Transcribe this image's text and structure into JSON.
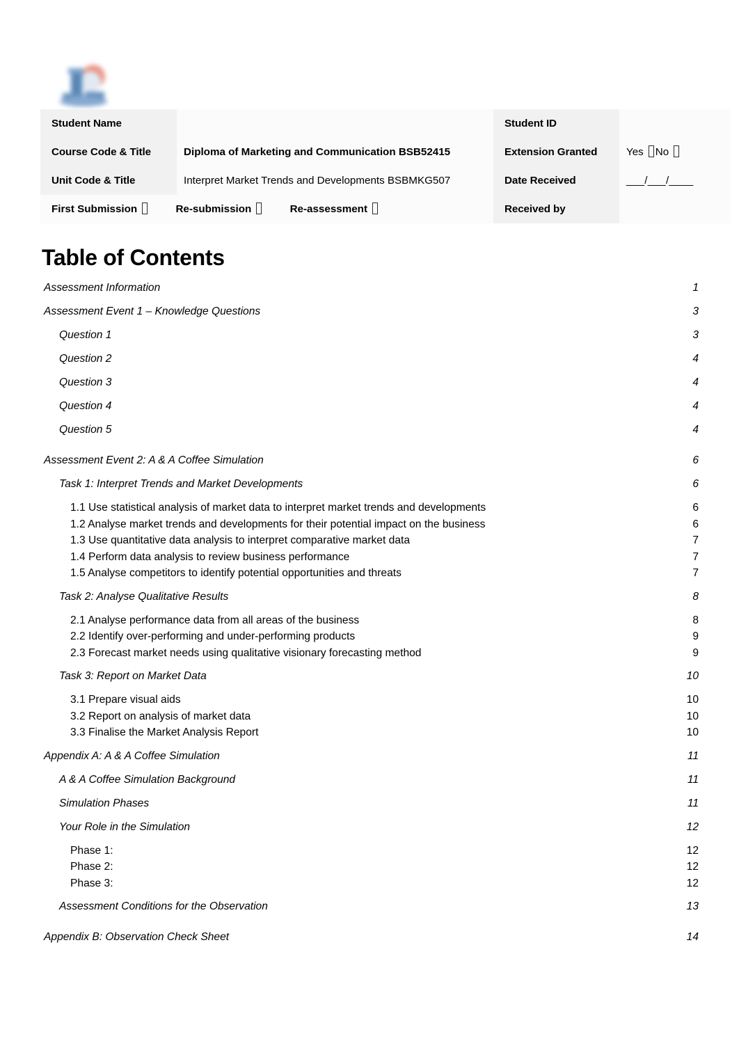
{
  "document": {
    "logo_alt": "institution-logo"
  },
  "header_table": {
    "rows": [
      {
        "left_label": "Student Name",
        "left_value": "",
        "right_label": "Student ID",
        "right_value": ""
      },
      {
        "left_label": "Course Code & Title",
        "left_value": "Diploma of Marketing and Communication BSB52415",
        "right_label": "Extension Granted",
        "right_value": "Yes",
        "right_value_2": "No"
      },
      {
        "left_label": "Unit Code & Title",
        "left_value": "Interpret Market Trends and Developments BSBMKG507",
        "right_label": "Date Received",
        "right_value": "___/___/____"
      }
    ],
    "submission_row": {
      "first_submission": "First Submission",
      "resubmission": "Re-submission",
      "reassessment": "Re-assessment",
      "received_by": "Received by"
    }
  },
  "toc": {
    "title": "Table of Contents",
    "entries": [
      {
        "label": "Assessment Information",
        "page": "1",
        "level": 1
      },
      {
        "label": "Assessment Event 1 – Knowledge Questions",
        "page": "3",
        "level": 1
      },
      {
        "label": "Question 1",
        "page": "3",
        "level": 2
      },
      {
        "label": "Question 2",
        "page": "4",
        "level": 2
      },
      {
        "label": "Question 3",
        "page": "4",
        "level": 2
      },
      {
        "label": "Question 4",
        "page": "4",
        "level": 2
      },
      {
        "label": "Question 5",
        "page": "4",
        "level": 2
      },
      {
        "label": "Assessment Event 2: A & A Coffee Simulation",
        "page": "6",
        "level": 1
      },
      {
        "label": "Task 1: Interpret Trends and Market Developments",
        "page": "6",
        "level": 2
      },
      {
        "label": "1.1 Use statistical analysis of market data to interpret market trends and developments",
        "page": "6",
        "level": 3
      },
      {
        "label": "1.2 Analyse market trends and developments for their potential impact on the business",
        "page": "6",
        "level": 3
      },
      {
        "label": "1.3 Use quantitative data analysis to interpret comparative market data",
        "page": "7",
        "level": 3
      },
      {
        "label": "1.4 Perform data analysis to review business performance",
        "page": "7",
        "level": 3
      },
      {
        "label": "1.5 Analyse competitors to identify potential opportunities and threats",
        "page": "7",
        "level": 3
      },
      {
        "label": "Task 2: Analyse Qualitative Results",
        "page": "8",
        "level": 2
      },
      {
        "label": "2.1 Analyse performance data from all areas of the business",
        "page": "8",
        "level": 3
      },
      {
        "label": "2.2 Identify over-performing and under-performing products",
        "page": "9",
        "level": 3
      },
      {
        "label": "2.3 Forecast market needs using qualitative visionary forecasting method",
        "page": "9",
        "level": 3
      },
      {
        "label": "Task 3: Report on Market Data",
        "page": "10",
        "level": 2
      },
      {
        "label": "3.1 Prepare visual aids",
        "page": "10",
        "level": 3
      },
      {
        "label": "3.2 Report on analysis of market data",
        "page": "10",
        "level": 3
      },
      {
        "label": "3.3 Finalise the Market Analysis Report",
        "page": "10",
        "level": 3
      },
      {
        "label": "Appendix A: A & A Coffee Simulation",
        "page": "11",
        "level": 1
      },
      {
        "label": "A & A Coffee Simulation Background",
        "page": "11",
        "level": 2
      },
      {
        "label": "Simulation Phases",
        "page": "11",
        "level": 2
      },
      {
        "label": "Your Role in the Simulation",
        "page": "12",
        "level": 2
      },
      {
        "label": "Phase 1:",
        "page": "12",
        "level": 3
      },
      {
        "label": "Phase 2:",
        "page": "12",
        "level": 3
      },
      {
        "label": "Phase 3:",
        "page": "12",
        "level": 3
      },
      {
        "label": "Assessment Conditions for the Observation",
        "page": "13",
        "level": 2
      },
      {
        "label": "Appendix B: Observation Check Sheet",
        "page": "14",
        "level": 1
      }
    ]
  },
  "colors": {
    "text": "#000000",
    "cell_label_bg": "#f1f1f1",
    "cell_value_bg": "#fbfbfb",
    "logo_blue": "#4f7fb5",
    "logo_red": "#e08878"
  }
}
